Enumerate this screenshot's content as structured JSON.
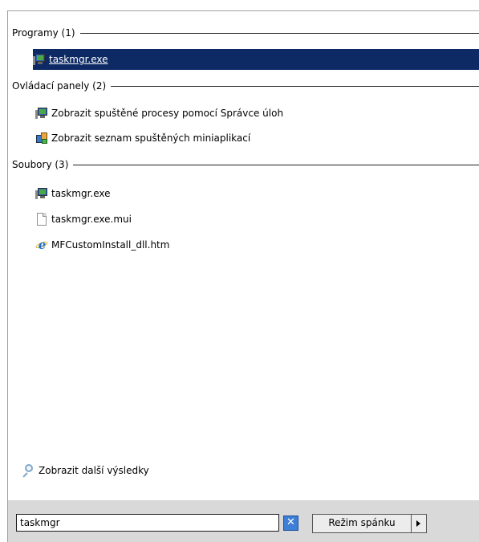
{
  "groups": {
    "programs": {
      "header": "Programy (1)",
      "items": [
        {
          "label": "taskmgr.exe",
          "icon": "task-manager-icon",
          "selected": true
        }
      ]
    },
    "control_panel": {
      "header": "Ovládací panely (2)",
      "items": [
        {
          "label": "Zobrazit spuštěné procesy pomocí Správce úloh",
          "icon": "task-manager-icon"
        },
        {
          "label": "Zobrazit seznam spuštěných miniaplikací",
          "icon": "gadgets-icon"
        }
      ]
    },
    "files": {
      "header": "Soubory (3)",
      "items": [
        {
          "label": "taskmgr.exe",
          "icon": "task-manager-icon"
        },
        {
          "label": "taskmgr.exe.mui",
          "icon": "blank-file-icon"
        },
        {
          "label": "MFCustomInstall_dll.htm",
          "icon": "internet-explorer-icon"
        }
      ]
    }
  },
  "more_results": {
    "label": "Zobrazit další výsledky",
    "icon": "search-icon"
  },
  "bottom": {
    "search_value": "taskmgr",
    "clear_icon": "clear-icon",
    "sleep_label": "Režim spánku",
    "arrow_icon": "arrow-right-icon"
  },
  "colors": {
    "selection": "#0d2a65",
    "bottom_bar": "#d9d9d9",
    "search_clear": "#3d7fd6"
  }
}
